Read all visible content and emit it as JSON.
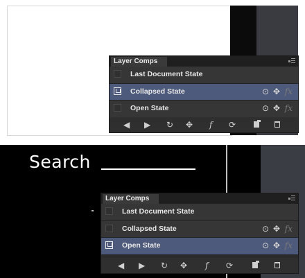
{
  "panel": {
    "tab_label": "Layer Comps",
    "toolbar_icons": [
      "prev-arrow-icon",
      "next-arrow-icon",
      "apply-visibility-icon",
      "apply-position-icon",
      "apply-style-icon",
      "update-icon",
      "new-comp-icon",
      "delete-icon"
    ],
    "toolbar_glyphs": {
      "prev": "◀",
      "next": "▶",
      "visibility": "↻",
      "position": "✥",
      "style": "f",
      "update": "⟳"
    },
    "indicator_glyphs": {
      "visibility": "⊙",
      "position": "✥",
      "style": "fx"
    }
  },
  "top_screenshot": {
    "rows": [
      {
        "label": "Last Document State",
        "selected": false,
        "indicators": false
      },
      {
        "label": "Collapsed State",
        "selected": true,
        "indicators": true
      },
      {
        "label": "Open State",
        "selected": false,
        "indicators": true
      }
    ]
  },
  "bottom_screenshot": {
    "search_label": "Search",
    "rows": [
      {
        "label": "Last Document State",
        "selected": false,
        "indicators": false
      },
      {
        "label": "Collapsed State",
        "selected": false,
        "indicators": true
      },
      {
        "label": "Open State",
        "selected": true,
        "indicators": true
      }
    ]
  },
  "colors": {
    "selection": "#4e5a7b",
    "panel_bg": "#2b2b2b",
    "row_bg": "#363636"
  }
}
